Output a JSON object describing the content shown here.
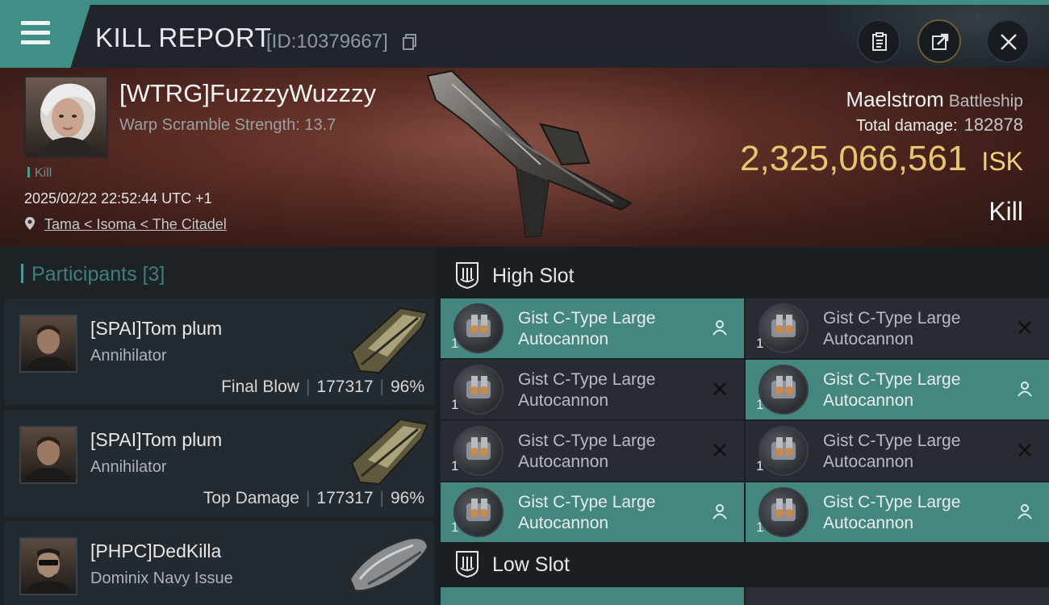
{
  "header": {
    "title": "KILL REPORT",
    "kill_id": "[ID:10379667]"
  },
  "victim": {
    "name": "[WTRG]FuzzzyWuzzzy",
    "scramble": "Warp Scramble Strength: 13.7",
    "tag": "Kill",
    "datetime": "2025/02/22 22:52:44 UTC +1",
    "location": "Tama < Isoma < The Citadel",
    "ship": "Maelstrom",
    "ship_class": "Battleship",
    "total_damage_label": "Total damage:",
    "total_damage": "182878",
    "isk_value": "2,325,066,561",
    "isk_unit": "ISK",
    "result": "Kill"
  },
  "participants": {
    "label": "Participants [3]",
    "items": [
      {
        "name": "[SPAI]Tom plum",
        "ship": "Annihilator",
        "role": "Final Blow",
        "damage": "177317",
        "percent": "96%"
      },
      {
        "name": "[SPAI]Tom plum",
        "ship": "Annihilator",
        "role": "Top Damage",
        "damage": "177317",
        "percent": "96%"
      },
      {
        "name": "[PHPC]DedKilla",
        "ship": "Dominix Navy Issue"
      }
    ]
  },
  "high_slot": {
    "label": "High Slot",
    "modules": [
      {
        "name": "Gist C-Type Large Autocannon",
        "qty": "1",
        "status": "fitted"
      },
      {
        "name": "Gist C-Type Large Autocannon",
        "qty": "1",
        "status": "destroyed"
      },
      {
        "name": "Gist C-Type Large Autocannon",
        "qty": "1",
        "status": "destroyed"
      },
      {
        "name": "Gist C-Type Large Autocannon",
        "qty": "1",
        "status": "fitted"
      },
      {
        "name": "Gist C-Type Large Autocannon",
        "qty": "1",
        "status": "destroyed"
      },
      {
        "name": "Gist C-Type Large Autocannon",
        "qty": "1",
        "status": "destroyed"
      },
      {
        "name": "Gist C-Type Large Autocannon",
        "qty": "1",
        "status": "fitted"
      },
      {
        "name": "Gist C-Type Large Autocannon",
        "qty": "1",
        "status": "fitted"
      }
    ]
  },
  "low_slot": {
    "label": "Low Slot"
  },
  "colors": {
    "accent": "#3f8f86",
    "fitted_bg": "#44877f",
    "isk": "#e9c46f",
    "banner": "#5c2d25"
  },
  "icons": [
    "menu-icon",
    "copy-icon",
    "clipboard-icon",
    "share-icon",
    "close-icon",
    "location-pin-icon",
    "shield-icon",
    "pilot-icon",
    "destroyed-x-icon",
    "autocannon-icon"
  ]
}
